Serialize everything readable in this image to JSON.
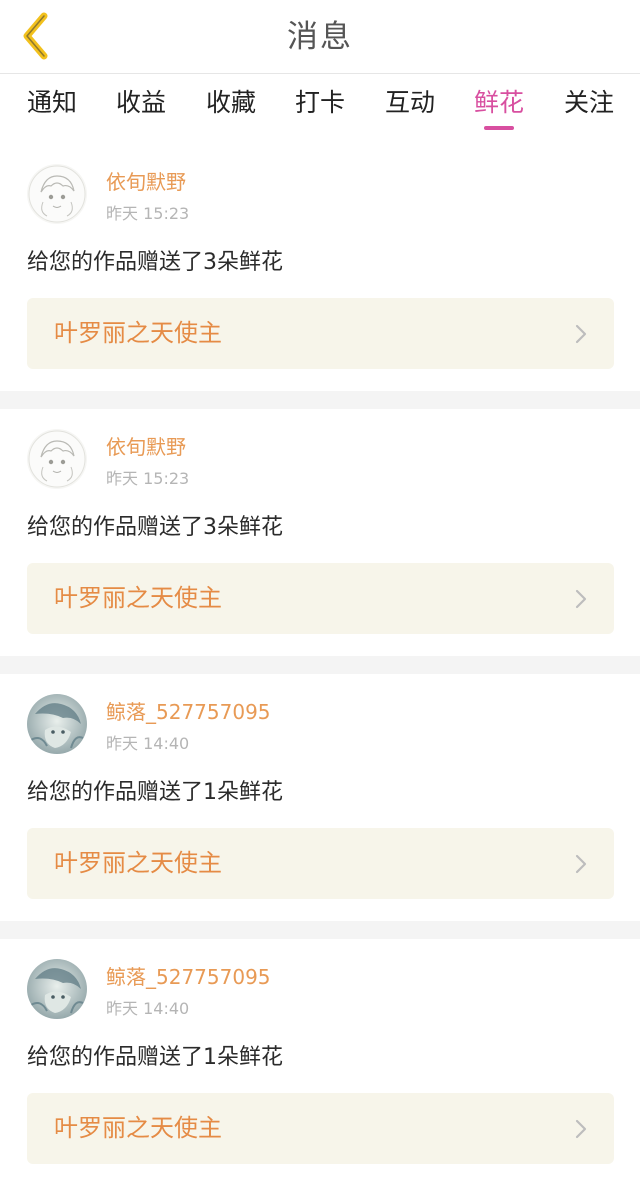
{
  "header": {
    "title": "消息",
    "back_icon": "chevron-left-icon",
    "back_icon_color": "#f2c11d"
  },
  "tabs": [
    {
      "label": "通知",
      "active": false
    },
    {
      "label": "收益",
      "active": false
    },
    {
      "label": "收藏",
      "active": false
    },
    {
      "label": "打卡",
      "active": false
    },
    {
      "label": "互动",
      "active": false
    },
    {
      "label": "鲜花",
      "active": true
    },
    {
      "label": "关注",
      "active": false
    }
  ],
  "messages": [
    {
      "avatar": "sketch-avatar",
      "user": "依旬默野",
      "time": "昨天 15:23",
      "text": "给您的作品赠送了3朵鲜花",
      "work_title": "叶罗丽之天使主"
    },
    {
      "avatar": "sketch-avatar",
      "user": "依旬默野",
      "time": "昨天 15:23",
      "text": "给您的作品赠送了3朵鲜花",
      "work_title": "叶罗丽之天使主"
    },
    {
      "avatar": "blue-avatar",
      "user": "鲸落_527757095",
      "time": "昨天 14:40",
      "text": "给您的作品赠送了1朵鲜花",
      "work_title": "叶罗丽之天使主"
    },
    {
      "avatar": "blue-avatar",
      "user": "鲸落_527757095",
      "time": "昨天 14:40",
      "text": "给您的作品赠送了1朵鲜花",
      "work_title": "叶罗丽之天使主"
    }
  ],
  "colors": {
    "accent": "#d84fa0",
    "username": "#e89a55",
    "work_title": "#e58b45",
    "work_bg": "#f7f5ea"
  }
}
